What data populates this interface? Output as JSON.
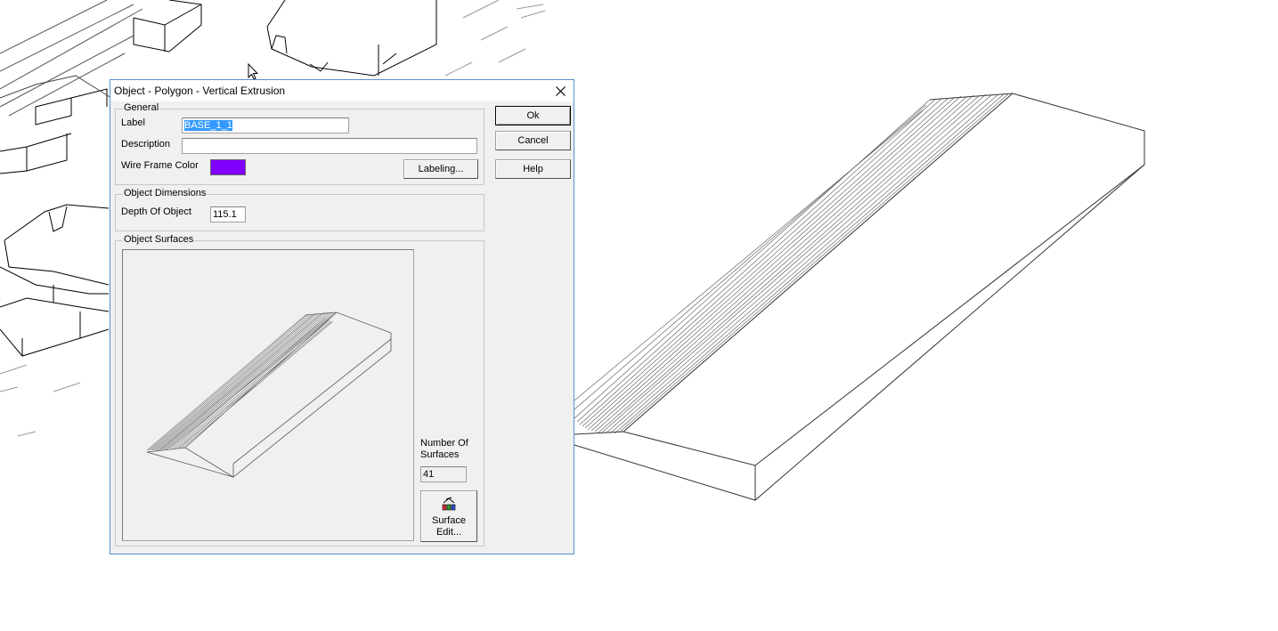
{
  "dialog": {
    "title": "Object - Polygon - Vertical Extrusion",
    "ok_label": "Ok",
    "cancel_label": "Cancel",
    "help_label": "Help",
    "general": {
      "title": "General",
      "label_caption": "Label",
      "label_value": "BASE_1_1",
      "description_caption": "Description",
      "description_value": "",
      "wire_frame_caption": "Wire Frame Color",
      "wire_frame_color": "#7f00ff",
      "labeling_button": "Labeling..."
    },
    "dimensions": {
      "title": "Object Dimensions",
      "depth_caption": "Depth Of Object",
      "depth_value": "115.1"
    },
    "surfaces": {
      "title": "Object Surfaces",
      "count_caption_line1": "Number Of",
      "count_caption_line2": "Surfaces",
      "count_value": "41",
      "edit_button_line1": "Surface",
      "edit_button_line2": "Edit..."
    }
  },
  "icons": [
    "close-icon",
    "surface-edit-icon",
    "mouse-pointer-icon"
  ]
}
